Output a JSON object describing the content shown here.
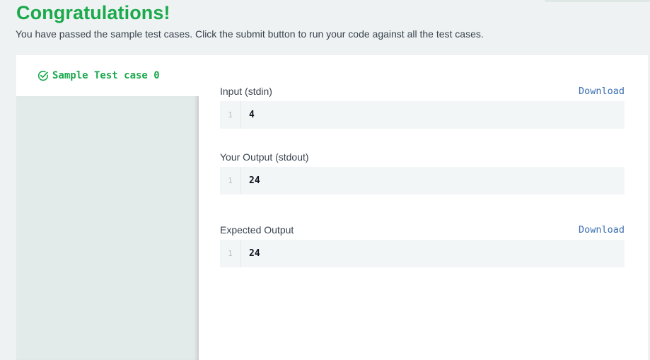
{
  "header": {
    "title": "Congratulations!",
    "subtitle": "You have passed the sample test cases. Click the submit button to run your code against all the test cases."
  },
  "tabs": [
    {
      "label": "Sample Test case 0",
      "icon": "check-circle-icon",
      "status": "passed"
    }
  ],
  "sections": {
    "input": {
      "label": "Input (stdin)",
      "download": "Download",
      "line_number": "1",
      "value": "4"
    },
    "output": {
      "label": "Your Output (stdout)",
      "line_number": "1",
      "value": "24"
    },
    "expected": {
      "label": "Expected Output",
      "download": "Download",
      "line_number": "1",
      "value": "24"
    }
  },
  "colors": {
    "success": "#1ba94c",
    "link": "#3b6fb0",
    "text": "#39424e",
    "background": "#eef2f3",
    "code_background": "#f3f6f7"
  }
}
